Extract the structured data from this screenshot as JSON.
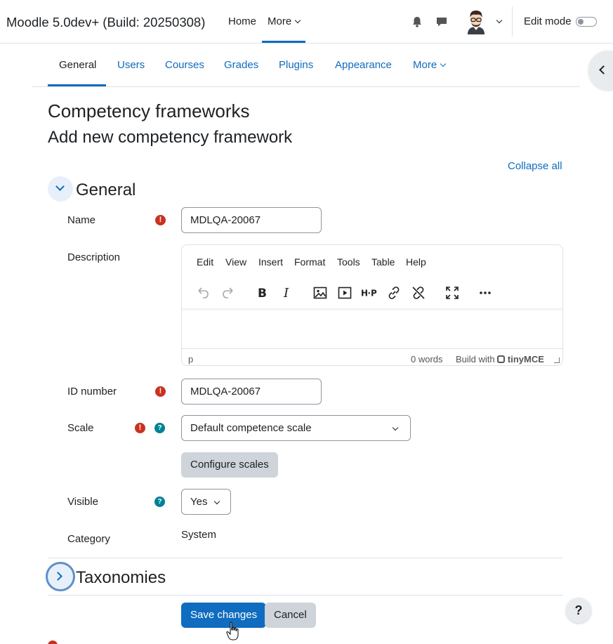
{
  "navbar": {
    "brand": "Moodle 5.0dev+ (Build: 20250308)",
    "home": "Home",
    "more": "More",
    "edit_mode": "Edit mode",
    "icons": [
      "bell-icon",
      "chat-icon",
      "avatar",
      "chevron-down-icon"
    ]
  },
  "secondary_nav": {
    "tabs": [
      {
        "label": "General",
        "active": true
      },
      {
        "label": "Users"
      },
      {
        "label": "Courses"
      },
      {
        "label": "Grades"
      },
      {
        "label": "Plugins"
      },
      {
        "label": "Appearance"
      },
      {
        "label": "More"
      }
    ]
  },
  "page": {
    "title": "Competency frameworks",
    "subtitle": "Add new competency framework",
    "collapse_all": "Collapse all"
  },
  "general": {
    "title": "General",
    "name": {
      "label": "Name",
      "value": "MDLQA-20067"
    },
    "description": {
      "label": "Description",
      "menu": [
        "Edit",
        "View",
        "Insert",
        "Format",
        "Tools",
        "Table",
        "Help"
      ],
      "status_path": "p",
      "word_count": "0 words",
      "build_with": "Build with",
      "tinymce": "tinyMCE"
    },
    "id_number": {
      "label": "ID number",
      "value": "MDLQA-20067"
    },
    "scale": {
      "label": "Scale",
      "value": "Default competence scale",
      "configure": "Configure scales"
    },
    "visible": {
      "label": "Visible",
      "value": "Yes"
    },
    "category": {
      "label": "Category",
      "value": "System"
    }
  },
  "taxonomies": {
    "title": "Taxonomies"
  },
  "actions": {
    "save": "Save changes",
    "cancel": "Cancel"
  },
  "help_button": "?",
  "colors": {
    "primary": "#0f6cbf",
    "required": "#ca3120",
    "help": "#008196"
  }
}
